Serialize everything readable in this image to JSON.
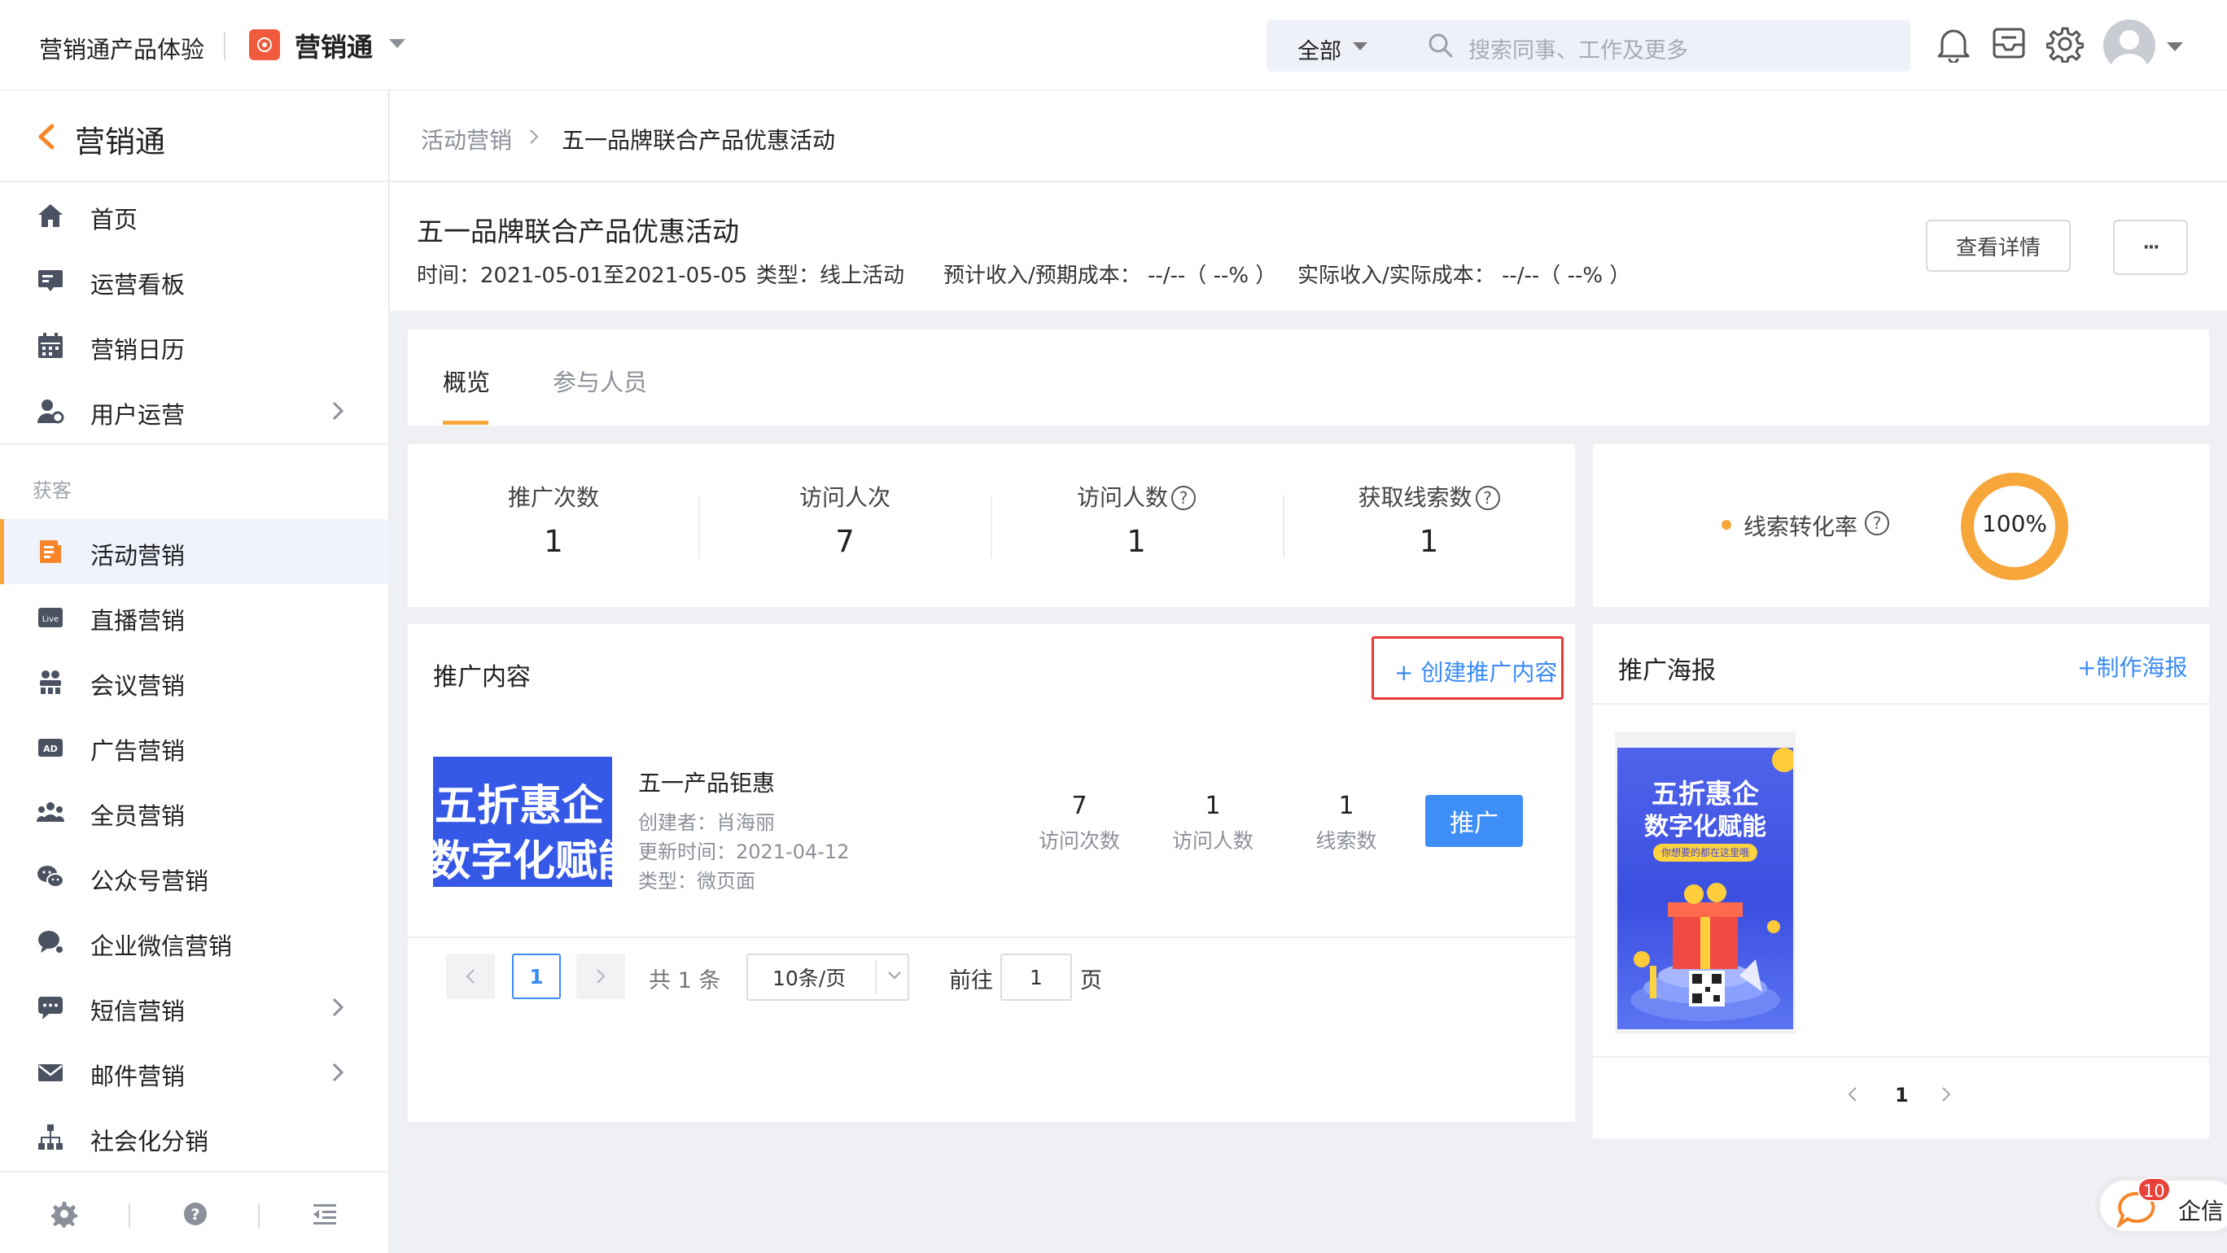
{
  "topbar": {
    "brand": "营销通产品体验",
    "app_name": "营销通",
    "search_scope": "全部",
    "search_placeholder": "搜索同事、工作及更多"
  },
  "sidebar": {
    "title": "营销通",
    "items": [
      {
        "label": "首页",
        "icon": "home-icon"
      },
      {
        "label": "运营看板",
        "icon": "dashboard-icon"
      },
      {
        "label": "营销日历",
        "icon": "calendar-icon"
      },
      {
        "label": "用户运营",
        "icon": "user-ops-icon",
        "expandable": true
      }
    ],
    "group_label": "获客",
    "group_items": [
      {
        "label": "活动营销",
        "icon": "activity-icon",
        "active": true
      },
      {
        "label": "直播营销",
        "icon": "live-icon"
      },
      {
        "label": "会议营销",
        "icon": "meeting-icon"
      },
      {
        "label": "广告营销",
        "icon": "ad-icon"
      },
      {
        "label": "全员营销",
        "icon": "all-staff-icon"
      },
      {
        "label": "公众号营销",
        "icon": "wechat-icon"
      },
      {
        "label": "企业微信营销",
        "icon": "wecom-icon"
      },
      {
        "label": "短信营销",
        "icon": "sms-icon",
        "expandable": true
      },
      {
        "label": "邮件营销",
        "icon": "mail-icon",
        "expandable": true
      },
      {
        "label": "社会化分销",
        "icon": "distribution-icon"
      }
    ]
  },
  "breadcrumb": {
    "parent": "活动营销",
    "current": "五一品牌联合产品优惠活动"
  },
  "activity": {
    "title": "五一品牌联合产品优惠活动",
    "time": "时间：2021-05-01至2021-05-05",
    "type": "类型：线上活动",
    "expected": "预计收入/预期成本：  --/--（ --% ）",
    "actual": "实际收入/实际成本：  --/--（ --% ）",
    "detail_button": "查看详情",
    "more_button": "···"
  },
  "tabs": [
    "概览",
    "参与人员"
  ],
  "stats": [
    {
      "label": "推广次数",
      "value": "1",
      "help": false
    },
    {
      "label": "访问人次",
      "value": "7",
      "help": false
    },
    {
      "label": "访问人数",
      "value": "1",
      "help": true
    },
    {
      "label": "获取线索数",
      "value": "1",
      "help": true
    }
  ],
  "conversion": {
    "label": "线索转化率",
    "value": "100%",
    "fraction": 1.0,
    "color": "#f7a63a"
  },
  "promo": {
    "title": "推广内容",
    "create_link": "+ 创建推广内容",
    "item": {
      "thumb_line1": "五折惠企",
      "thumb_line2": "数字化赋能",
      "name": "五一产品钜惠",
      "creator": "创建者：肖海丽",
      "updated": "更新时间：2021-04-12",
      "type": "类型：微页面",
      "visits": "7",
      "visits_label": "访问次数",
      "visitors": "1",
      "visitors_label": "访问人数",
      "leads": "1",
      "leads_label": "线索数",
      "action": "推广"
    },
    "pagination": {
      "current": "1",
      "total": "共 1 条",
      "page_size": "10条/页",
      "goto_prefix": "前往",
      "goto_value": "1",
      "goto_suffix": "页"
    }
  },
  "poster": {
    "title": "推广海报",
    "create_link": "+制作海报",
    "image_line1": "五折惠企",
    "image_line2": "数字化赋能",
    "image_tag": "你想要的都在这里哦",
    "page": "1"
  },
  "qixin": {
    "label": "企信",
    "badge": "10"
  }
}
